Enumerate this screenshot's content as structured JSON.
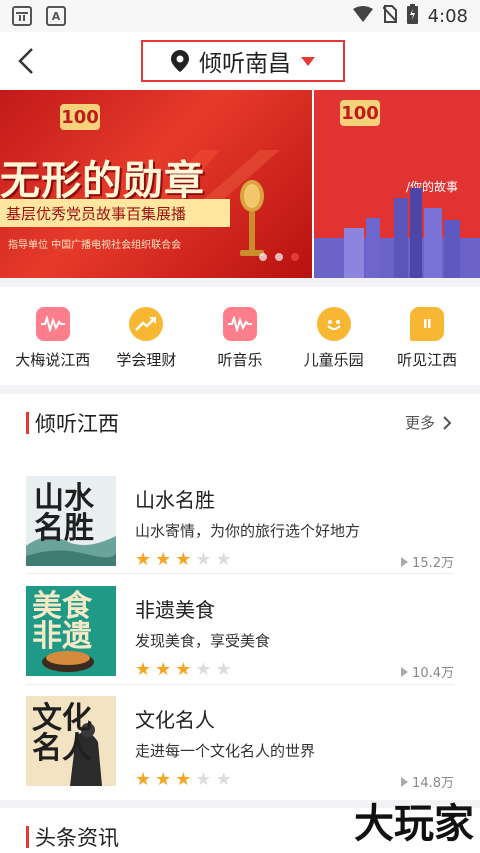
{
  "status_bar": {
    "time": "4:08",
    "left_icons": [
      "notification-icon",
      "app-a-icon"
    ],
    "right_icons": [
      "wifi-icon",
      "no-sim-icon",
      "battery-icon"
    ],
    "app_badge": "A"
  },
  "header": {
    "location": "倾听南昌"
  },
  "banner": {
    "title": "无形的勋章",
    "subtitle": "基层优秀党员故事百集展播",
    "small_text": "指导单位  中国广播电视社会组织联合会",
    "badge": "100",
    "slide2_caption": "/你的故事",
    "active_dot": 2,
    "dot_count": 3
  },
  "categories": [
    {
      "label": "大梅说江西",
      "icon": "waveform-icon",
      "color": "#ff6b7a"
    },
    {
      "label": "学会理财",
      "icon": "trend-up-icon",
      "color": "#f7b733"
    },
    {
      "label": "听音乐",
      "icon": "waveform-icon",
      "color": "#ff6b7a"
    },
    {
      "label": "儿童乐园",
      "icon": "smiley-face-icon",
      "color": "#f7b733"
    },
    {
      "label": "听见江西",
      "icon": "chat-bubble-icon",
      "color": "#f7b733"
    }
  ],
  "section1": {
    "title": "倾听江西",
    "more": "更多",
    "items": [
      {
        "title": "山水名胜",
        "desc": "山水寄情，为你的旅行选个好地方",
        "rating": 3,
        "plays": "15.2万",
        "thumb_text": "山水名胜",
        "thumb_bg": "#e9eef0"
      },
      {
        "title": "非遗美食",
        "desc": "发现美食，享受美食",
        "rating": 3,
        "plays": "10.4万",
        "thumb_text": "美食非遗",
        "thumb_bg": "#1f9a86"
      },
      {
        "title": "文化名人",
        "desc": "走进每一个文化名人的世界",
        "rating": 3,
        "plays": "14.8万",
        "thumb_text": "文化名人",
        "thumb_bg": "#f2e3c2"
      }
    ]
  },
  "section2": {
    "title": "头条资讯"
  },
  "watermark": "大玩家",
  "colors": {
    "accent": "#e53935",
    "star": "#f5a623"
  }
}
